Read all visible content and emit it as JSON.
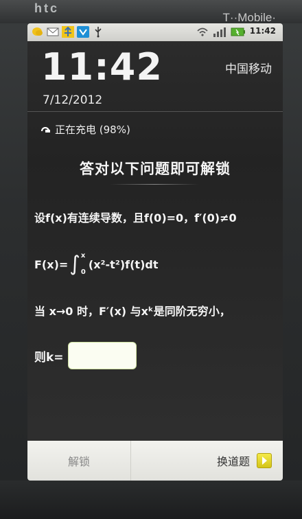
{
  "device": {
    "brand_left": "htc",
    "brand_right": "T··Mobile·"
  },
  "status_bar": {
    "time": "11:42",
    "icons_left": [
      "chat-icon",
      "mail-icon",
      "usb-debug-icon",
      "bluetooth-app-icon",
      "usb-icon"
    ],
    "icons_right": [
      "wifi-icon",
      "signal-icon",
      "battery-icon"
    ]
  },
  "lockscreen": {
    "time": "11:42",
    "carrier": "中国移动",
    "date": "7/12/2012",
    "charging": "正在充电 (98%)"
  },
  "question": {
    "title": "答对以下问题即可解锁",
    "line1": "设f(x)有连续导数，且f(0)=0，f′(0)≠0",
    "line2_prefix": "F(x)=",
    "line2_suffix": "(x²-t²)f(t)dt",
    "integral_upper": "x",
    "integral_lower": "0",
    "line3": "当 x→0 时，F′(x) 与xᵏ是同阶无穷小，",
    "answer_label": "则k=",
    "answer_value": ""
  },
  "buttons": {
    "unlock": "解锁",
    "next": "换道题"
  }
}
